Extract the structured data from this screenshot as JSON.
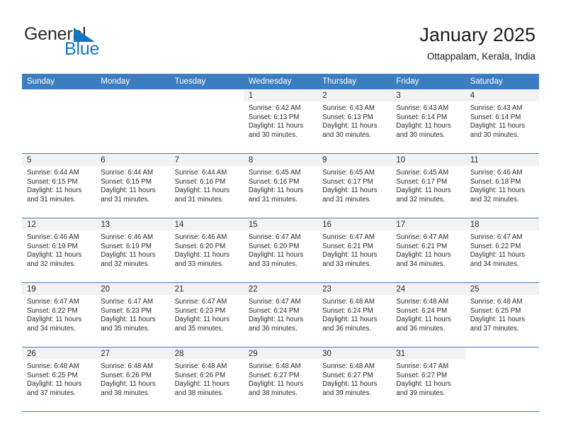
{
  "brand": {
    "name_part1": "General",
    "name_part2": "Blue",
    "logo_icon": "blue-triangle-icon",
    "color_primary": "#1278be",
    "color_text": "#2b2b2b"
  },
  "header": {
    "title": "January 2025",
    "location": "Ottappalam, Kerala, India"
  },
  "theme": {
    "header_row_bg": "#3c7ebf",
    "day_band_bg": "#f2f2f2",
    "page_bg": "#ffffff"
  },
  "weekdays": [
    "Sunday",
    "Monday",
    "Tuesday",
    "Wednesday",
    "Thursday",
    "Friday",
    "Saturday"
  ],
  "weeks": [
    [
      {
        "blank": true
      },
      {
        "blank": true
      },
      {
        "blank": true
      },
      {
        "day": "1",
        "sunrise": "Sunrise: 6:42 AM",
        "sunset": "Sunset: 6:13 PM",
        "daylight1": "Daylight: 11 hours",
        "daylight2": "and 30 minutes."
      },
      {
        "day": "2",
        "sunrise": "Sunrise: 6:43 AM",
        "sunset": "Sunset: 6:13 PM",
        "daylight1": "Daylight: 11 hours",
        "daylight2": "and 30 minutes."
      },
      {
        "day": "3",
        "sunrise": "Sunrise: 6:43 AM",
        "sunset": "Sunset: 6:14 PM",
        "daylight1": "Daylight: 11 hours",
        "daylight2": "and 30 minutes."
      },
      {
        "day": "4",
        "sunrise": "Sunrise: 6:43 AM",
        "sunset": "Sunset: 6:14 PM",
        "daylight1": "Daylight: 11 hours",
        "daylight2": "and 30 minutes."
      }
    ],
    [
      {
        "day": "5",
        "sunrise": "Sunrise: 6:44 AM",
        "sunset": "Sunset: 6:15 PM",
        "daylight1": "Daylight: 11 hours",
        "daylight2": "and 31 minutes."
      },
      {
        "day": "6",
        "sunrise": "Sunrise: 6:44 AM",
        "sunset": "Sunset: 6:15 PM",
        "daylight1": "Daylight: 11 hours",
        "daylight2": "and 31 minutes."
      },
      {
        "day": "7",
        "sunrise": "Sunrise: 6:44 AM",
        "sunset": "Sunset: 6:16 PM",
        "daylight1": "Daylight: 11 hours",
        "daylight2": "and 31 minutes."
      },
      {
        "day": "8",
        "sunrise": "Sunrise: 6:45 AM",
        "sunset": "Sunset: 6:16 PM",
        "daylight1": "Daylight: 11 hours",
        "daylight2": "and 31 minutes."
      },
      {
        "day": "9",
        "sunrise": "Sunrise: 6:45 AM",
        "sunset": "Sunset: 6:17 PM",
        "daylight1": "Daylight: 11 hours",
        "daylight2": "and 31 minutes."
      },
      {
        "day": "10",
        "sunrise": "Sunrise: 6:45 AM",
        "sunset": "Sunset: 6:17 PM",
        "daylight1": "Daylight: 11 hours",
        "daylight2": "and 32 minutes."
      },
      {
        "day": "11",
        "sunrise": "Sunrise: 6:46 AM",
        "sunset": "Sunset: 6:18 PM",
        "daylight1": "Daylight: 11 hours",
        "daylight2": "and 32 minutes."
      }
    ],
    [
      {
        "day": "12",
        "sunrise": "Sunrise: 6:46 AM",
        "sunset": "Sunset: 6:19 PM",
        "daylight1": "Daylight: 11 hours",
        "daylight2": "and 32 minutes."
      },
      {
        "day": "13",
        "sunrise": "Sunrise: 6:46 AM",
        "sunset": "Sunset: 6:19 PM",
        "daylight1": "Daylight: 11 hours",
        "daylight2": "and 32 minutes."
      },
      {
        "day": "14",
        "sunrise": "Sunrise: 6:46 AM",
        "sunset": "Sunset: 6:20 PM",
        "daylight1": "Daylight: 11 hours",
        "daylight2": "and 33 minutes."
      },
      {
        "day": "15",
        "sunrise": "Sunrise: 6:47 AM",
        "sunset": "Sunset: 6:20 PM",
        "daylight1": "Daylight: 11 hours",
        "daylight2": "and 33 minutes."
      },
      {
        "day": "16",
        "sunrise": "Sunrise: 6:47 AM",
        "sunset": "Sunset: 6:21 PM",
        "daylight1": "Daylight: 11 hours",
        "daylight2": "and 33 minutes."
      },
      {
        "day": "17",
        "sunrise": "Sunrise: 6:47 AM",
        "sunset": "Sunset: 6:21 PM",
        "daylight1": "Daylight: 11 hours",
        "daylight2": "and 34 minutes."
      },
      {
        "day": "18",
        "sunrise": "Sunrise: 6:47 AM",
        "sunset": "Sunset: 6:22 PM",
        "daylight1": "Daylight: 11 hours",
        "daylight2": "and 34 minutes."
      }
    ],
    [
      {
        "day": "19",
        "sunrise": "Sunrise: 6:47 AM",
        "sunset": "Sunset: 6:22 PM",
        "daylight1": "Daylight: 11 hours",
        "daylight2": "and 34 minutes."
      },
      {
        "day": "20",
        "sunrise": "Sunrise: 6:47 AM",
        "sunset": "Sunset: 6:23 PM",
        "daylight1": "Daylight: 11 hours",
        "daylight2": "and 35 minutes."
      },
      {
        "day": "21",
        "sunrise": "Sunrise: 6:47 AM",
        "sunset": "Sunset: 6:23 PM",
        "daylight1": "Daylight: 11 hours",
        "daylight2": "and 35 minutes."
      },
      {
        "day": "22",
        "sunrise": "Sunrise: 6:47 AM",
        "sunset": "Sunset: 6:24 PM",
        "daylight1": "Daylight: 11 hours",
        "daylight2": "and 36 minutes."
      },
      {
        "day": "23",
        "sunrise": "Sunrise: 6:48 AM",
        "sunset": "Sunset: 6:24 PM",
        "daylight1": "Daylight: 11 hours",
        "daylight2": "and 36 minutes."
      },
      {
        "day": "24",
        "sunrise": "Sunrise: 6:48 AM",
        "sunset": "Sunset: 6:24 PM",
        "daylight1": "Daylight: 11 hours",
        "daylight2": "and 36 minutes."
      },
      {
        "day": "25",
        "sunrise": "Sunrise: 6:48 AM",
        "sunset": "Sunset: 6:25 PM",
        "daylight1": "Daylight: 11 hours",
        "daylight2": "and 37 minutes."
      }
    ],
    [
      {
        "day": "26",
        "sunrise": "Sunrise: 6:48 AM",
        "sunset": "Sunset: 6:25 PM",
        "daylight1": "Daylight: 11 hours",
        "daylight2": "and 37 minutes."
      },
      {
        "day": "27",
        "sunrise": "Sunrise: 6:48 AM",
        "sunset": "Sunset: 6:26 PM",
        "daylight1": "Daylight: 11 hours",
        "daylight2": "and 38 minutes."
      },
      {
        "day": "28",
        "sunrise": "Sunrise: 6:48 AM",
        "sunset": "Sunset: 6:26 PM",
        "daylight1": "Daylight: 11 hours",
        "daylight2": "and 38 minutes."
      },
      {
        "day": "29",
        "sunrise": "Sunrise: 6:48 AM",
        "sunset": "Sunset: 6:27 PM",
        "daylight1": "Daylight: 11 hours",
        "daylight2": "and 38 minutes."
      },
      {
        "day": "30",
        "sunrise": "Sunrise: 6:48 AM",
        "sunset": "Sunset: 6:27 PM",
        "daylight1": "Daylight: 11 hours",
        "daylight2": "and 39 minutes."
      },
      {
        "day": "31",
        "sunrise": "Sunrise: 6:47 AM",
        "sunset": "Sunset: 6:27 PM",
        "daylight1": "Daylight: 11 hours",
        "daylight2": "and 39 minutes."
      },
      {
        "blank": true
      }
    ]
  ]
}
